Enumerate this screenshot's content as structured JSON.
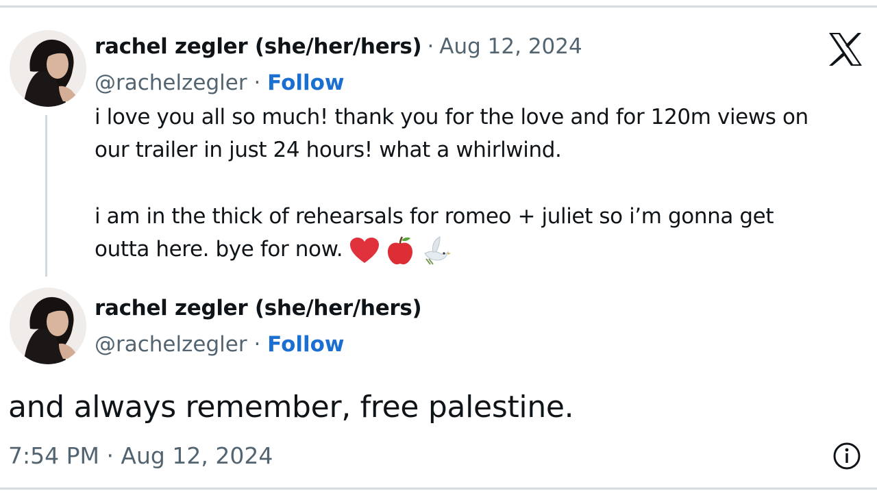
{
  "tweet1": {
    "display_name": "rachel zegler (she/her/hers)",
    "separator": "·",
    "date": "Aug 12, 2024",
    "handle": "@rachelzegler",
    "handle_separator": "·",
    "follow_label": "Follow",
    "text_line1": "i love you all so much! thank you for the love and for 120m views on",
    "text_line2": "our trailer in just 24 hours! what a whirlwind.",
    "text_line3": "i am in the thick of rehearsals for romeo + juliet so i’m gonna get",
    "text_line4": "outta here. bye for now.",
    "emojis": [
      "heart-emoji",
      "apple-emoji",
      "dove-emoji"
    ]
  },
  "tweet2": {
    "display_name": "rachel zegler (she/her/hers)",
    "handle": "@rachelzegler",
    "handle_separator": "·",
    "follow_label": "Follow",
    "text": "and always remember, free palestine.",
    "timestamp": "7:54 PM · Aug 12, 2024"
  },
  "icons": {
    "brand": "x-logo-icon",
    "info": "info-icon"
  },
  "colors": {
    "follow": "#1a6fd0",
    "secondary_text": "#536471",
    "primary_text": "#0f1419",
    "thread_line": "#cfd9de"
  }
}
